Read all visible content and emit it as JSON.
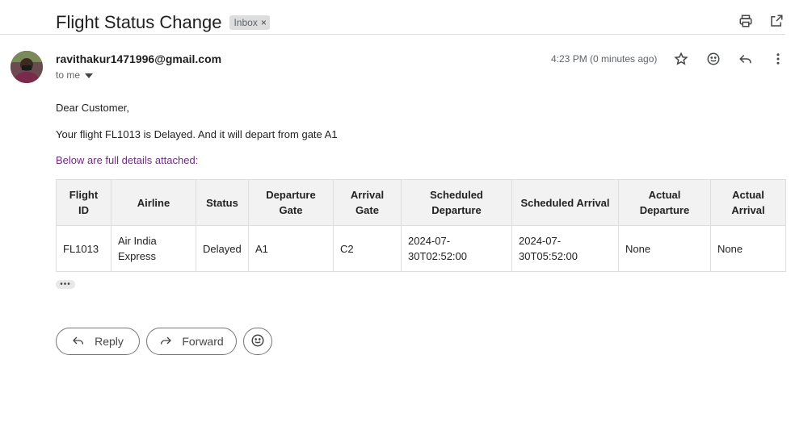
{
  "subject": "Flight Status Change",
  "label": "Inbox",
  "label_close": "×",
  "sender": {
    "email": "ravithakur1471996@gmail.com",
    "to": "to me"
  },
  "timestamp": "4:23 PM (0 minutes ago)",
  "body": {
    "greeting": "Dear Customer,",
    "line1": "Your flight FL1013 is Delayed. And it will depart from gate A1",
    "line2": "Below are full details attached:"
  },
  "table": {
    "headers": [
      "Flight ID",
      "Airline",
      "Status",
      "Departure Gate",
      "Arrival Gate",
      "Scheduled Departure",
      "Scheduled Arrival",
      "Actual Departure",
      "Actual Arrival"
    ],
    "rows": [
      [
        "FL1013",
        "Air India Express",
        "Delayed",
        "A1",
        "C2",
        "2024-07-30T02:52:00",
        "2024-07-30T05:52:00",
        "None",
        "None"
      ]
    ]
  },
  "more_dots": "•••",
  "actions": {
    "reply": "Reply",
    "forward": "Forward"
  },
  "icons": [
    "print-icon",
    "open-in-new-window-icon",
    "star-icon",
    "emoji-icon",
    "reply-icon",
    "more-vert-icon",
    "chevron-down-icon"
  ]
}
